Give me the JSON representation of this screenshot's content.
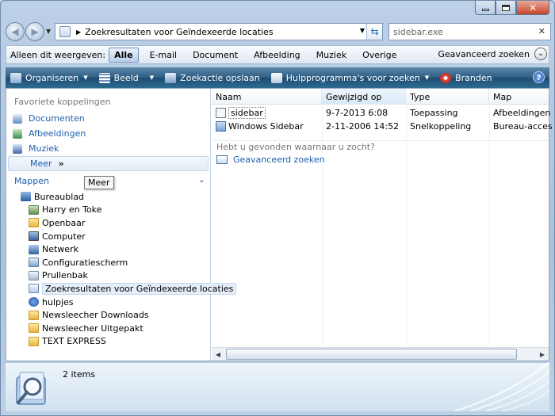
{
  "window": {
    "address_path": "Zoekresultaten voor Geïndexeerde locaties",
    "search_value": "sidebar.exe"
  },
  "filter": {
    "label": "Alleen dit weergeven:",
    "items": [
      "Alle",
      "E-mail",
      "Document",
      "Afbeelding",
      "Muziek",
      "Overige"
    ],
    "active": "Alle",
    "advanced": "Geavanceerd zoeken"
  },
  "commandbar": {
    "organize": "Organiseren",
    "view": "Beeld",
    "save_search": "Zoekactie opslaan",
    "search_tools": "Hulpprogramma's voor zoeken",
    "burn": "Branden",
    "help": "?"
  },
  "navpane": {
    "favorites_header": "Favoriete koppelingen",
    "favorites": [
      "Documenten",
      "Afbeeldingen",
      "Muziek"
    ],
    "more": "Meer",
    "more_arrows": "»",
    "folders_header": "Mappen",
    "tooltip": "Meer",
    "tree": [
      {
        "label": "Bureaublad",
        "icon": "desktop-icon"
      },
      {
        "label": "Harry en Toke",
        "icon": "user-folder-icon"
      },
      {
        "label": "Openbaar",
        "icon": "folder-icon"
      },
      {
        "label": "Computer",
        "icon": "computer-icon"
      },
      {
        "label": "Netwerk",
        "icon": "network-icon"
      },
      {
        "label": "Configuratiescherm",
        "icon": "control-panel-icon"
      },
      {
        "label": "Prullenbak",
        "icon": "recycle-bin-icon"
      },
      {
        "label": "Zoekresultaten voor Geïndexeerde locaties",
        "icon": "search-results-icon"
      },
      {
        "label": "hulpjes",
        "icon": "help-folder-icon"
      },
      {
        "label": "Newsleecher Downloads",
        "icon": "folder-icon"
      },
      {
        "label": "Newsleecher Uitgepakt",
        "icon": "folder-icon"
      },
      {
        "label": "TEXT EXPRESS",
        "icon": "folder-icon"
      }
    ]
  },
  "list": {
    "columns": [
      "Naam",
      "Gewijzigd op",
      "Type",
      "Map"
    ],
    "rows": [
      {
        "name": "sidebar",
        "modified": "9-7-2013 6:08",
        "type": "Toepassing",
        "folder": "Afbeeldingen (C"
      },
      {
        "name": "Windows Sidebar",
        "modified": "2-11-2006 14:52",
        "type": "Snelkoppeling",
        "folder": "Bureau-accesso"
      }
    ],
    "found_question": "Hebt u gevonden waarnaar u zocht?",
    "advanced_link": "Geavanceerd zoeken"
  },
  "details": {
    "count": "2 items"
  },
  "colors": {
    "link": "#1e5fad",
    "cmdbar": "#2f5e84"
  }
}
